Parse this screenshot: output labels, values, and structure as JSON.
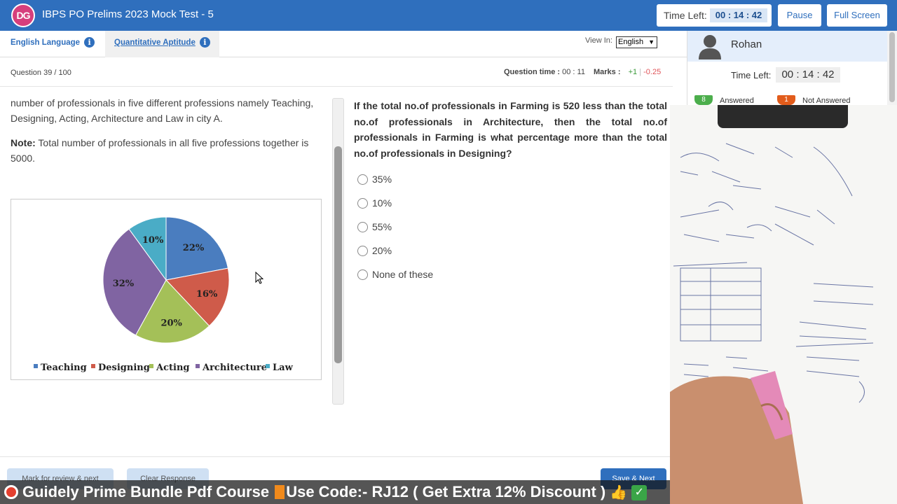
{
  "header": {
    "logo": "DG",
    "title": "IBPS PO Prelims 2023 Mock Test - 5",
    "time_left_label": "Time Left:",
    "time_left_value": "00 : 14 : 42",
    "pause_label": "Pause",
    "fullscreen_label": "Full Screen"
  },
  "sections": [
    {
      "label": "English Language",
      "active": false
    },
    {
      "label": "Quantitative Aptitude",
      "active": true
    }
  ],
  "view_in": {
    "label": "View In:",
    "selected": "English"
  },
  "question_meta": {
    "number": "Question 39 / 100",
    "time_label": "Question time :",
    "time_value": "00 : 11",
    "marks_label": "Marks :",
    "positive": "+1",
    "separator": "|",
    "negative": "-0.25"
  },
  "passage": {
    "text": "number of professionals in five different professions namely Teaching, Designing, Acting, Architecture and Law in city A.",
    "note_label": "Note:",
    "note_text": "Total number of professionals in all five professions together is 5000."
  },
  "chart_data": {
    "type": "pie",
    "categories": [
      "Teaching",
      "Designing",
      "Acting",
      "Architecture",
      "Law"
    ],
    "values": [
      22,
      16,
      20,
      32,
      10
    ],
    "labels": [
      "22%",
      "16%",
      "20%",
      "32%",
      "10%"
    ],
    "colors": [
      "#4a7dbf",
      "#cf5b4a",
      "#a4c058",
      "#8064a2",
      "#4aacc6"
    ],
    "legend_position": "bottom"
  },
  "question": {
    "text": "If the total no.of professionals in Farming is 520 less than the total no.of professionals in Architecture, then the total no.of professionals in Farming is what percentage more than the total no.of professionals in Designing?",
    "options": [
      "35%",
      "10%",
      "55%",
      "20%",
      "None of these"
    ]
  },
  "right_panel": {
    "username": "Rohan",
    "time_left_label": "Time Left:",
    "time_left_value": "00 : 14 : 42",
    "answered_count": "8",
    "answered_label": "Answered",
    "not_answered_count": "1",
    "not_answered_label": "Not Answered"
  },
  "footer": {
    "mark_review_label": "Mark for review & next",
    "clear_label": "Clear Response",
    "save_next_label": "Save & Next"
  },
  "banner": {
    "text": "Guidely Prime Bundle Pdf Course",
    "code_text": "Use Code:- RJ12 ( Get Extra 12% Discount )"
  }
}
